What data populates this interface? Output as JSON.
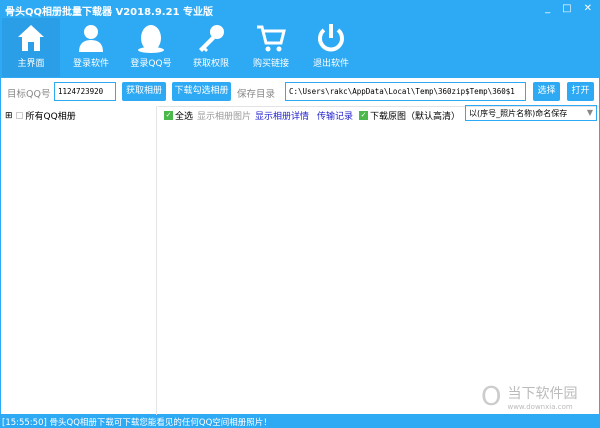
{
  "window": {
    "title": "骨头QQ相册批量下载器 V2018.9.21 专业版",
    "min": "_",
    "max": "□",
    "close": "✕"
  },
  "toolbar": [
    {
      "label": "主界面",
      "icon": "home-icon"
    },
    {
      "label": "登录软件",
      "icon": "user-icon"
    },
    {
      "label": "登录QQ号",
      "icon": "qq-icon"
    },
    {
      "label": "获取权限",
      "icon": "key-icon"
    },
    {
      "label": "购买链接",
      "icon": "cart-icon"
    },
    {
      "label": "退出软件",
      "icon": "power-icon"
    }
  ],
  "form": {
    "qq_label": "目标QQ号",
    "qq_value": "1124723920",
    "fetch": "获取相册",
    "download": "下载勾选相册",
    "dir_label": "保存目录",
    "dir_value": "C:\\Users\\rakc\\AppData\\Local\\Temp\\360zip$Temp\\360$1",
    "choose": "选择",
    "open": "打开"
  },
  "tree": {
    "root": "所有QQ相册",
    "expander": "⊞"
  },
  "options": {
    "select_all": "全选",
    "show_images": "显示相册图片",
    "show_details": "显示相册详情",
    "transfer_log": "传输记录",
    "download_original": "下载原图（默认高清）",
    "naming": "以(序号_照片名称)命名保存"
  },
  "status": "[15:55:50] 骨头QQ相册下载可下载您能看见的任何QQ空间相册照片！",
  "watermark": {
    "name": "当下软件园",
    "url": "www.downxia.com"
  }
}
